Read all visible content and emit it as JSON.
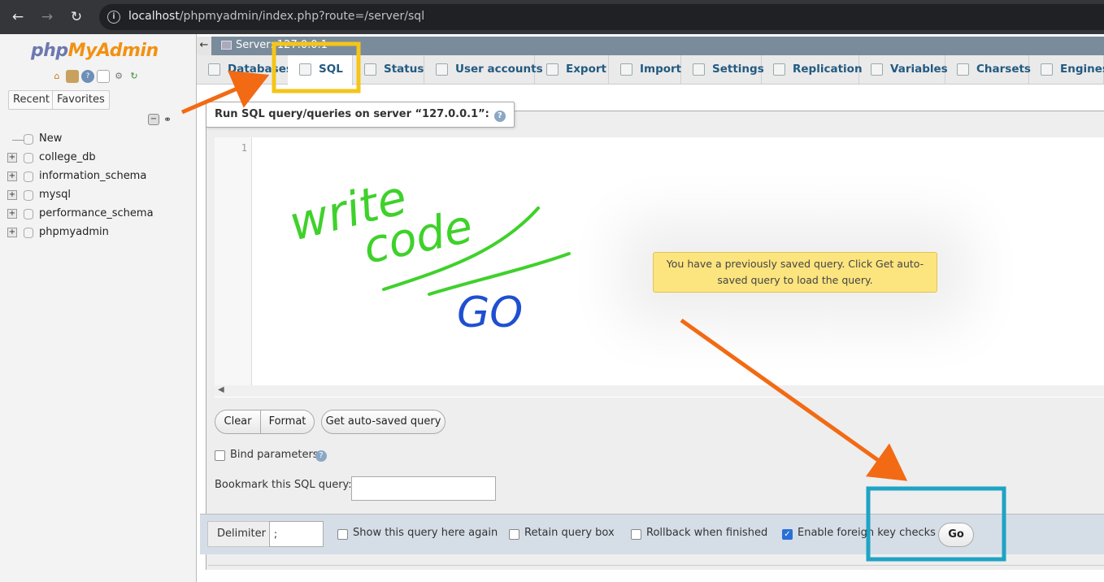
{
  "browser": {
    "url_host": "localhost",
    "url_path": "/phpmyadmin/index.php?route=/server/sql"
  },
  "sidebar": {
    "logo_php": "php",
    "logo_my": "MyAdmin",
    "tabs": [
      "Recent",
      "Favorites"
    ],
    "new_label": "New",
    "databases": [
      "college_db",
      "information_schema",
      "mysql",
      "performance_schema",
      "phpmyadmin"
    ]
  },
  "server_bar": {
    "label": "Server: 127.0.0.1"
  },
  "tabs": [
    {
      "label": "Databases",
      "icon": "database-icon"
    },
    {
      "label": "SQL",
      "icon": "sql-icon",
      "active": true
    },
    {
      "label": "Status",
      "icon": "status-icon"
    },
    {
      "label": "User accounts",
      "icon": "users-icon"
    },
    {
      "label": "Export",
      "icon": "export-icon"
    },
    {
      "label": "Import",
      "icon": "import-icon"
    },
    {
      "label": "Settings",
      "icon": "wrench-icon"
    },
    {
      "label": "Replication",
      "icon": "replication-icon"
    },
    {
      "label": "Variables",
      "icon": "variables-icon"
    },
    {
      "label": "Charsets",
      "icon": "charsets-icon"
    },
    {
      "label": "Engines",
      "icon": "engines-icon"
    }
  ],
  "query_panel": {
    "legend": "Run SQL query/queries on server “127.0.0.1”:",
    "line_number": "1",
    "autosave_notice": "You have a previously saved query. Click Get auto-saved query to load the query.",
    "clear_label": "Clear",
    "format_label": "Format",
    "autosave_label": "Get auto-saved query",
    "bind_label": "Bind parameters",
    "bookmark_label": "Bookmark this SQL query:"
  },
  "bottom_bar": {
    "delimiter_label": "Delimiter",
    "delimiter_value": ";",
    "options": [
      {
        "label": "Show this query here again",
        "checked": false
      },
      {
        "label": "Retain query box",
        "checked": false
      },
      {
        "label": "Rollback when finished",
        "checked": false
      },
      {
        "label": "Enable foreign key checks",
        "checked": true
      }
    ],
    "go_label": "Go"
  },
  "annotations": {
    "handwritten_line1": "write",
    "handwritten_line2": "code",
    "handwritten_go": "GO",
    "highlight_sql_color": "#f5c518",
    "highlight_go_color": "#1fa3c4",
    "arrow_color": "#f26a14",
    "pen_green": "#3fd12b",
    "pen_blue": "#1f4fd1"
  }
}
